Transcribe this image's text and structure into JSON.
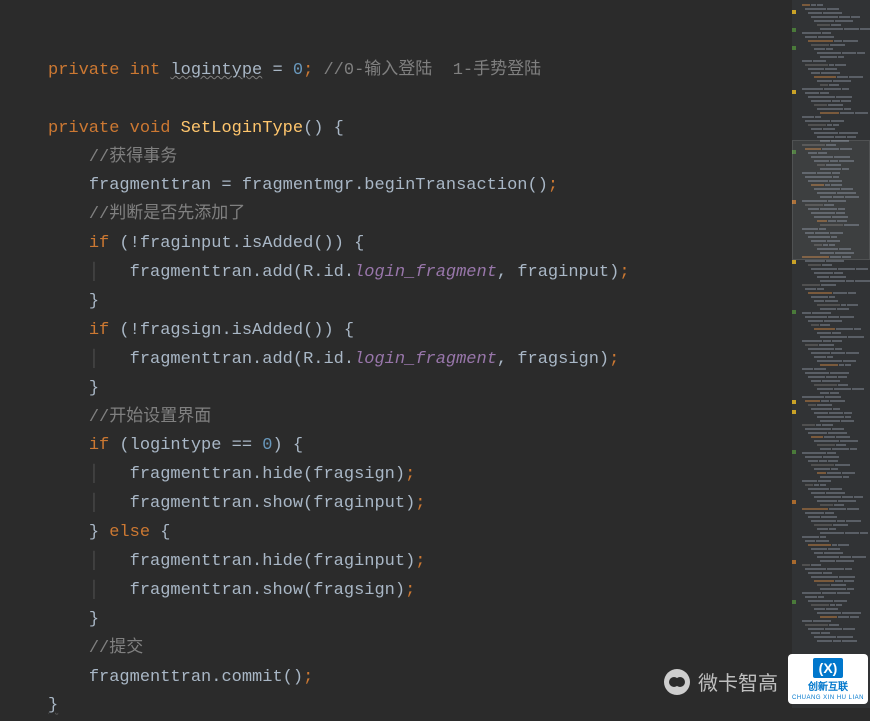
{
  "code": {
    "l1": {
      "kw1": "private",
      "kw2": "int",
      "var": "logintype",
      "eq": " = ",
      "num": "0",
      "semi": ";",
      "comment": " //0-输入登陆  1-手势登陆"
    },
    "l3": {
      "kw1": "private",
      "kw2": "void",
      "method": "SetLoginType",
      "parens": "()",
      " brace": " {"
    },
    "l4": {
      "comment": "//获得事务"
    },
    "l5": {
      "text1": "fragmenttran = fragmentmgr",
      "dot": ".",
      "call": "beginTransaction()",
      "semi": ";"
    },
    "l6": {
      "comment": "//判断是否先添加了"
    },
    "l7": {
      "kw": "if",
      "open": " (",
      "neg": "!",
      "id": "fraginput",
      "dot": ".",
      "call": "isAdded()",
      "close": ") {"
    },
    "l8": {
      "id": "fragmenttran",
      "dot": ".",
      "call": "add(",
      "r": "R",
      "dot2": ".",
      "id2": "id",
      "dot3": ".",
      "field": "login_fragment",
      "comma": ", ",
      "arg": "fraginput)",
      "semi": ";"
    },
    "l9": {
      "brace": "}"
    },
    "l10": {
      "kw": "if",
      "open": " (",
      "neg": "!",
      "id": "fragsign",
      "dot": ".",
      "call": "isAdded()",
      "close": ") {"
    },
    "l11": {
      "id": "fragmenttran",
      "dot": ".",
      "call": "add(",
      "r": "R",
      "dot2": ".",
      "id2": "id",
      "dot3": ".",
      "field": "login_fragment",
      "comma": ", ",
      "arg": "fragsign)",
      "semi": ";"
    },
    "l12": {
      "brace": "}"
    },
    "l13": {
      "comment": "//开始设置界面"
    },
    "l14": {
      "kw": "if",
      "open": " (logintype == ",
      "num": "0",
      "close": ") {"
    },
    "l15": {
      "id": "fragmenttran",
      "dot": ".",
      "call": "hide(fragsign)",
      "semi": ";"
    },
    "l16": {
      "id": "fragmenttran",
      "dot": ".",
      "call": "show(fraginput)",
      "semi": ";"
    },
    "l17": {
      "brace": "} ",
      "kw": "else",
      "open": " {"
    },
    "l18": {
      "id": "fragmenttran",
      "dot": ".",
      "call": "hide(fraginput)",
      "semi": ";"
    },
    "l19": {
      "id": "fragmenttran",
      "dot": ".",
      "call": "show(fragsign)",
      "semi": ";"
    },
    "l20": {
      "brace": "}"
    },
    "l21": {
      "comment": "//提交"
    },
    "l22": {
      "id": "fragmenttran",
      "dot": ".",
      "call": "commit()",
      "semi": ";"
    },
    "l23": {
      "brace": "}"
    }
  },
  "watermark": {
    "text": "微卡智高"
  },
  "corner": {
    "main": "创新互联",
    "sub": "CHUANG XIN HU LIAN",
    "badge": "(X)"
  }
}
